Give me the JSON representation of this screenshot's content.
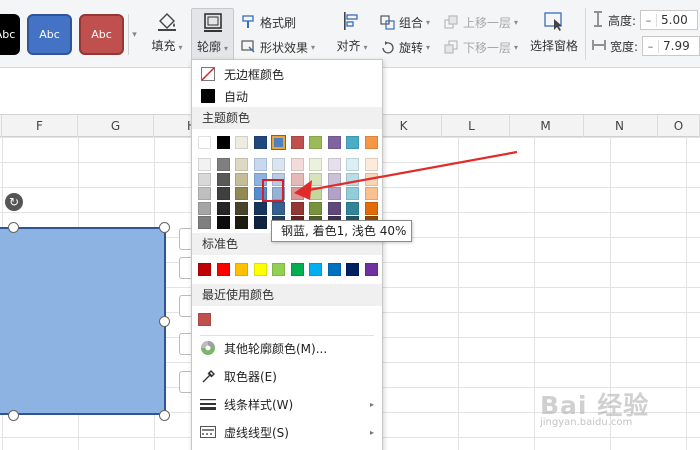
{
  "ribbon": {
    "style_presets": [
      {
        "label": "Abc",
        "color": "#000000"
      },
      {
        "label": "Abc",
        "color": "#4472c4"
      },
      {
        "label": "Abc",
        "color": "#c0504d"
      }
    ],
    "fill_label": "填充",
    "outline_label": "轮廓",
    "format_painter_label": "格式刷",
    "shape_effect_label": "形状效果",
    "align_label": "对齐",
    "group_label": "组合",
    "rotate_label": "旋转",
    "bring_forward_label": "上移一层",
    "send_backward_label": "下移一层",
    "selection_pane_label": "选择窗格",
    "height_label": "高度:",
    "height_value": "5.00",
    "width_label": "宽度:",
    "width_value": "7.99"
  },
  "sheet": {
    "columns": [
      "F",
      "G",
      "H",
      "I",
      "J",
      "K",
      "L",
      "M",
      "N",
      "O"
    ]
  },
  "outline_menu": {
    "no_border_label": "无边框颜色",
    "auto_label": "自动",
    "theme_section": "主题颜色",
    "theme_row": [
      "#ffffff",
      "#000000",
      "#eeece1",
      "#1f497d",
      "#4f81bd",
      "#c0504d",
      "#9bbb59",
      "#8064a2",
      "#4bacc6",
      "#f79646"
    ],
    "theme_grid": [
      [
        "#f2f2f2",
        "#7f7f7f",
        "#ddd9c3",
        "#c6d9f0",
        "#dbe5f1",
        "#f2dcdb",
        "#ebf1dd",
        "#e5e0ec",
        "#dbeef3",
        "#fdeada"
      ],
      [
        "#d8d8d8",
        "#595959",
        "#c4bd97",
        "#8db3e2",
        "#b8cce4",
        "#e5b9b7",
        "#d7e3bc",
        "#ccc1d9",
        "#b7dde8",
        "#fbd5b5"
      ],
      [
        "#bfbfbf",
        "#3f3f3f",
        "#938953",
        "#548dd4",
        "#95b3d7",
        "#d99694",
        "#c3d69b",
        "#b2a2c7",
        "#92cddc",
        "#fac08f"
      ],
      [
        "#a5a5a5",
        "#262626",
        "#494429",
        "#17365d",
        "#366092",
        "#953734",
        "#76923c",
        "#5f497a",
        "#31859b",
        "#e36c09"
      ],
      [
        "#7f7f7f",
        "#0c0c0c",
        "#1d1b10",
        "#0f243e",
        "#244061",
        "#632423",
        "#4f6128",
        "#3f3151",
        "#205867",
        "#974806"
      ]
    ],
    "standard_section": "标准色",
    "standard_colors": [
      "#c00000",
      "#ff0000",
      "#ffc000",
      "#ffff00",
      "#92d050",
      "#00b050",
      "#00b0f0",
      "#0070c0",
      "#002060",
      "#7030a0"
    ],
    "recent_section": "最近使用颜色",
    "recent_colors": [
      "#c0504d"
    ],
    "more_colors_label": "其他轮廓颜色(M)...",
    "eyedropper_label": "取色器(E)",
    "line_style_label": "线条样式(W)",
    "dash_type_label": "虚线线型(S)"
  },
  "tooltip": {
    "text": "钢蓝, 着色1, 浅色 40%"
  },
  "watermark": {
    "brand": "Bai 经验",
    "url": "jingyan.baidu.com"
  }
}
